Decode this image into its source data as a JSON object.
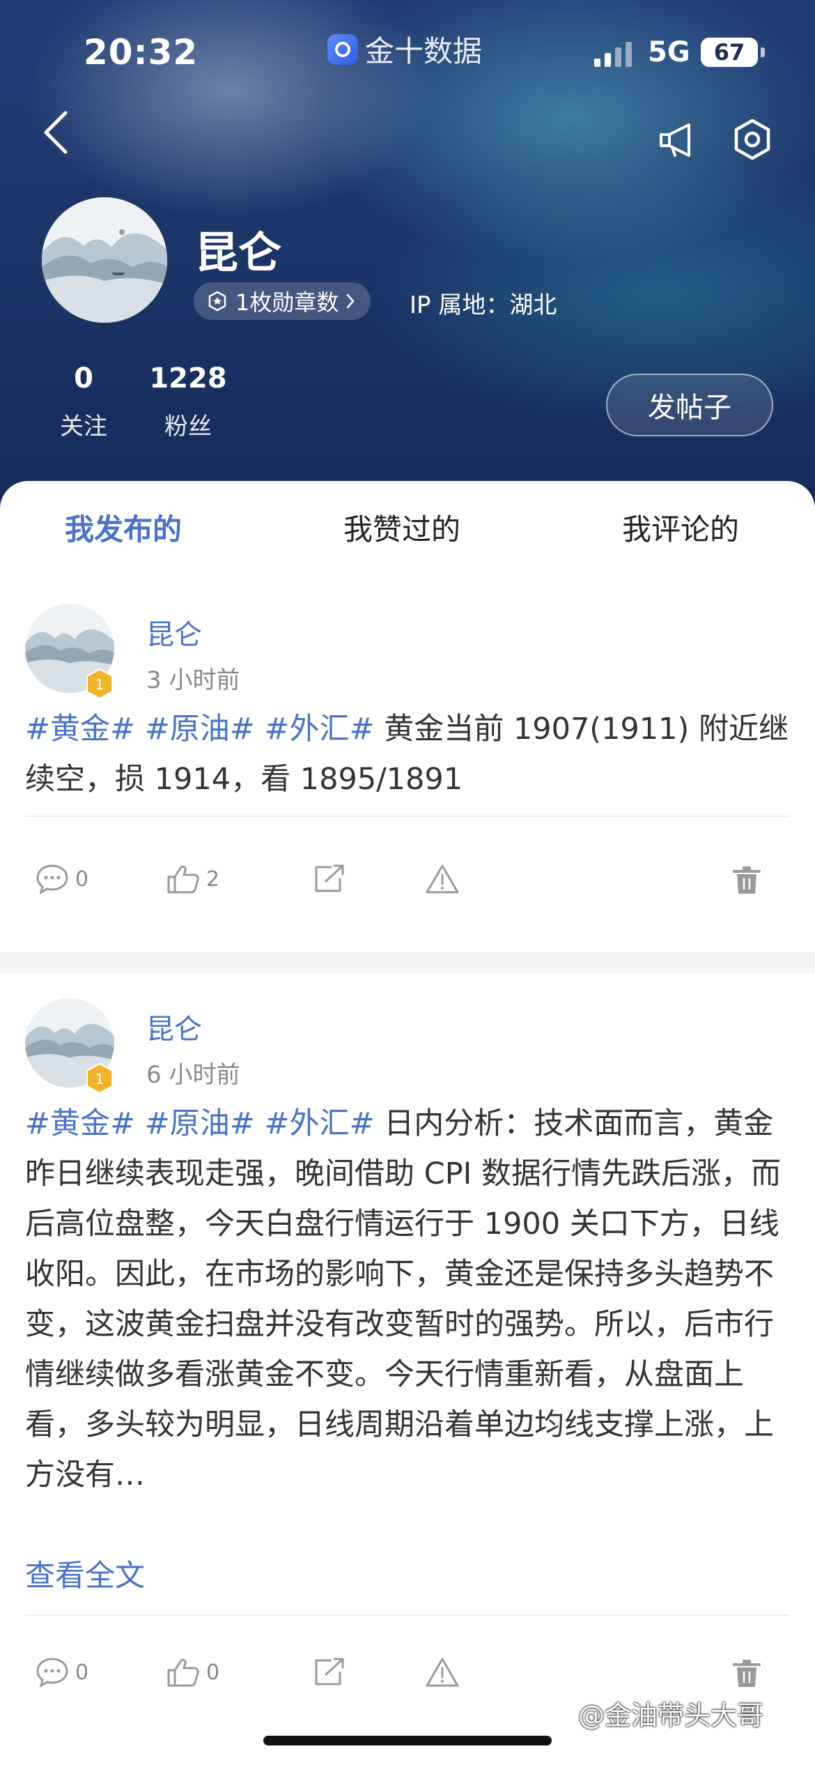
{
  "status_bar": {
    "time": "20:32",
    "app_name": "金十数据",
    "network": "5G",
    "battery": "67"
  },
  "profile": {
    "name": "昆仑",
    "medals": "1枚勋章数",
    "ip_location": "IP 属地：湖北",
    "following_count": "0",
    "following_label": "关注",
    "followers_count": "1228",
    "followers_label": "粉丝",
    "post_button": "发帖子"
  },
  "tabs": [
    {
      "label": "我发布的",
      "active": true
    },
    {
      "label": "我赞过的",
      "active": false
    },
    {
      "label": "我评论的",
      "active": false
    }
  ],
  "posts": [
    {
      "author": "昆仑",
      "time_ago": "3 小时前",
      "medal_level": "1",
      "tags": [
        "#黄金#",
        "#原油#",
        "#外汇#"
      ],
      "text": "黄金当前 1907(1911) 附近继续空，损 1914，看 1895/1891",
      "comments": "0",
      "likes": "2"
    },
    {
      "author": "昆仑",
      "time_ago": "6 小时前",
      "medal_level": "1",
      "tags": [
        "#黄金#",
        "#原油#",
        "#外汇#"
      ],
      "text": "日内分析：技术面而言，黄金昨日继续表现走强，晚间借助 CPI 数据行情先跌后涨，而后高位盘整，今天白盘行情运行于 1900 关口下方，日线收阳。因此，在市场的影响下，黄金还是保持多头趋势不变，这波黄金扫盘并没有改变暂时的强势。所以，后市行情继续做多看涨黄金不变。今天行情重新看，从盘面上看，多头较为明显，日线周期沿着单边均线支撑上涨，上方没有…",
      "read_more": "查看全文",
      "comments": "0",
      "likes": "0"
    }
  ],
  "watermark": "@金油带头大哥",
  "colors": {
    "accent": "#4a72c5",
    "header_bg": "#1c3668",
    "medal": "#f0b429"
  },
  "icons": [
    "back-arrow-icon",
    "megaphone-icon",
    "settings-hexagon-icon",
    "medal-icon",
    "comment-icon",
    "thumbs-up-icon",
    "share-icon",
    "warning-icon",
    "trash-icon"
  ]
}
